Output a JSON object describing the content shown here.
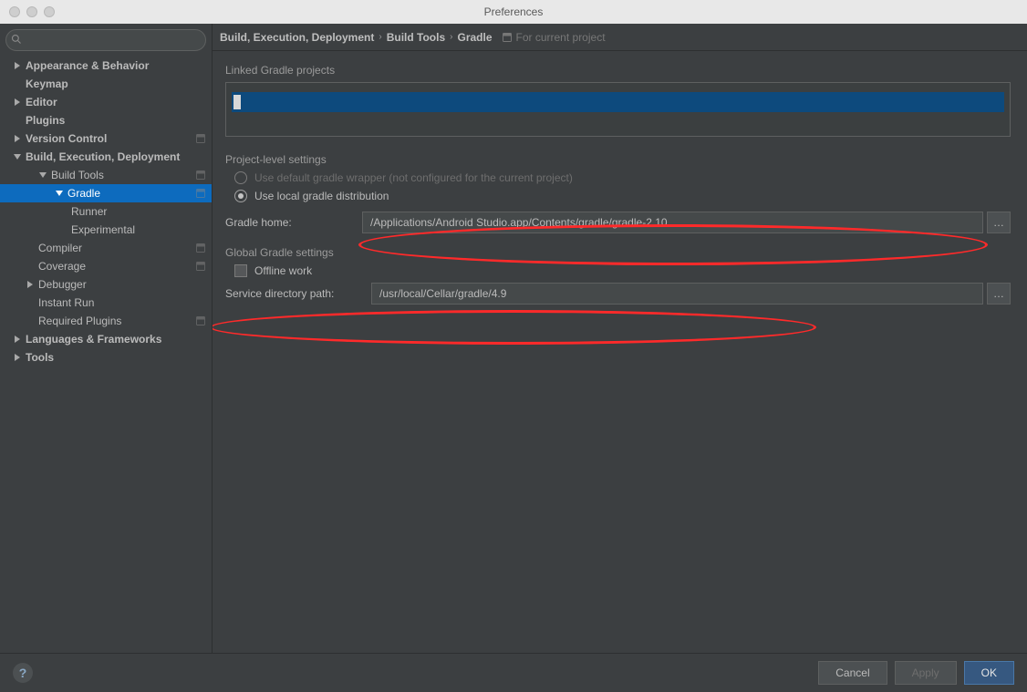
{
  "window": {
    "title": "Preferences"
  },
  "search": {
    "placeholder": ""
  },
  "sidebar": {
    "items": [
      {
        "label": "Appearance & Behavior",
        "bold": true,
        "pad": 1,
        "arrow": "right"
      },
      {
        "label": "Keymap",
        "bold": true,
        "pad": 2,
        "arrow": ""
      },
      {
        "label": "Editor",
        "bold": true,
        "pad": 1,
        "arrow": "right"
      },
      {
        "label": "Plugins",
        "bold": true,
        "pad": 2,
        "arrow": ""
      },
      {
        "label": "Version Control",
        "bold": true,
        "pad": 1,
        "arrow": "right",
        "badge": true
      },
      {
        "label": "Build, Execution, Deployment",
        "bold": true,
        "pad": 1,
        "arrow": "down"
      },
      {
        "label": "Build Tools",
        "bold": false,
        "pad": 3,
        "arrow": "down",
        "badge": true
      },
      {
        "label": "Gradle",
        "bold": false,
        "pad": 4,
        "arrow": "down",
        "badge": true,
        "selected": true
      },
      {
        "label": "Runner",
        "bold": false,
        "pad": 5,
        "arrow": ""
      },
      {
        "label": "Experimental",
        "bold": false,
        "pad": 5,
        "arrow": ""
      },
      {
        "label": "Compiler",
        "bold": false,
        "pad": 3,
        "arrow": "",
        "badge": true
      },
      {
        "label": "Coverage",
        "bold": false,
        "pad": 3,
        "arrow": "",
        "badge": true
      },
      {
        "label": "Debugger",
        "bold": false,
        "pad": 2,
        "arrow": "right"
      },
      {
        "label": "Instant Run",
        "bold": false,
        "pad": 3,
        "arrow": ""
      },
      {
        "label": "Required Plugins",
        "bold": false,
        "pad": 3,
        "arrow": "",
        "badge": true
      },
      {
        "label": "Languages & Frameworks",
        "bold": true,
        "pad": 1,
        "arrow": "right"
      },
      {
        "label": "Tools",
        "bold": true,
        "pad": 1,
        "arrow": "right"
      }
    ]
  },
  "breadcrumb": {
    "items": [
      "Build, Execution, Deployment",
      "Build Tools",
      "Gradle"
    ],
    "scope": "For current project"
  },
  "panel": {
    "linked_label": "Linked Gradle projects",
    "project_settings_label": "Project-level settings",
    "use_default_label": "Use default gradle wrapper (not configured for the current project)",
    "use_local_label": "Use local gradle distribution",
    "gradle_home_label": "Gradle home:",
    "gradle_home_value": "/Applications/Android Studio.app/Contents/gradle/gradle-2.10",
    "global_label": "Global Gradle settings",
    "offline_label": "Offline work",
    "service_dir_label": "Service directory path:",
    "service_dir_value": "/usr/local/Cellar/gradle/4.9"
  },
  "footer": {
    "help_glyph": "?",
    "cancel": "Cancel",
    "apply": "Apply",
    "ok": "OK"
  }
}
